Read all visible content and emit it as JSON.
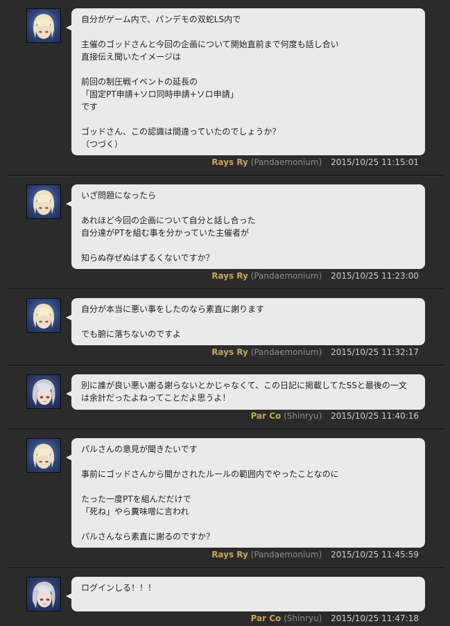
{
  "comments": [
    {
      "author": "Rays Ry",
      "world": "(Pandaemonium)",
      "timestamp": "2015/10/25 11:15:01",
      "avatar": "rays-ry",
      "text": "自分がゲーム内で、パンデモの双蛇LS内で\n\n主催のゴッドさんと今回の企画について開始直前まで何度も話し合い\n直接伝え聞いたイメージは\n\n前回の制圧戦イベントの延長の\n「固定PT申請+ソロ同時申請+ソロ申請」\nです\n\nゴッドさん、この認識は間違っていたのでしょうか？\n（つづく）"
    },
    {
      "author": "Rays Ry",
      "world": "(Pandaemonium)",
      "timestamp": "2015/10/25 11:23:00",
      "avatar": "rays-ry",
      "text": "いざ問題になったら\n\nあれほど今回の企画について自分と話し合った\n自分達がPTを組む事を分かっていた主催者が\n\n知らぬ存ぜぬはずるくないですか？"
    },
    {
      "author": "Rays Ry",
      "world": "(Pandaemonium)",
      "timestamp": "2015/10/25 11:32:17",
      "avatar": "rays-ry",
      "text": "自分が本当に悪い事をしたのなら素直に謝ります\n\nでも腑に落ちないのですよ"
    },
    {
      "author": "Par Co",
      "world": "(Shinryu)",
      "timestamp": "2015/10/25 11:40:16",
      "avatar": "par-co",
      "text": "別に誰が良い悪い謝る謝らないとかじゃなくて、この日記に掲載してたSSと最後の一文\nは余計だったよねってことだよ思うよ！"
    },
    {
      "author": "Rays Ry",
      "world": "(Pandaemonium)",
      "timestamp": "2015/10/25 11:45:59",
      "avatar": "rays-ry",
      "text": "パルさんの意見が聞きたいです\n\n事前にゴッドさんから聞かされたルールの範囲内でやったことなのに\n\nたった一度PTを組んだだけで\n「死ね」やら糞味噌に言われ\n\nパルさんなら素直に謝るのですか？"
    },
    {
      "author": "Par Co",
      "world": "(Shinryu)",
      "timestamp": "2015/10/25 11:47:18",
      "avatar": "par-co",
      "text": "ログインしる！！！"
    }
  ],
  "colors": {
    "background": "#2b2b2b",
    "bubble": "#eaeaea",
    "author_name": "#c7a55a",
    "world_name": "#8e8e8e",
    "timestamp": "#cfcfcf"
  }
}
